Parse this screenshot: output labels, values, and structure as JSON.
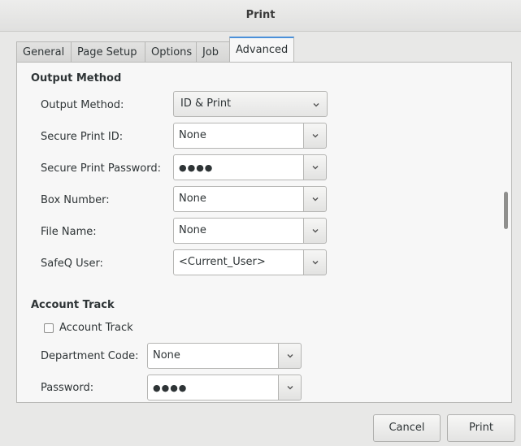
{
  "window": {
    "title": "Print"
  },
  "tabs": [
    {
      "label": "General"
    },
    {
      "label": "Page Setup"
    },
    {
      "label": "Options"
    },
    {
      "label": "Job"
    },
    {
      "label": "Advanced",
      "active": true
    }
  ],
  "output_method": {
    "heading": "Output Method",
    "output_method": {
      "label": "Output Method:",
      "value": "ID & Print"
    },
    "secure_print_id": {
      "label": "Secure Print ID:",
      "value": "None"
    },
    "secure_print_password": {
      "label": "Secure Print Password:",
      "value": "●●●●"
    },
    "box_number": {
      "label": "Box Number:",
      "value": "None"
    },
    "file_name": {
      "label": "File Name:",
      "value": "None"
    },
    "safeq_user": {
      "label": "SafeQ User:",
      "value": "<Current_User>"
    }
  },
  "account_track": {
    "heading": "Account Track",
    "checkbox_label": "Account Track",
    "checked": false,
    "department_code": {
      "label": "Department Code:",
      "value": "None"
    },
    "password": {
      "label": "Password:",
      "value": "●●●●"
    }
  },
  "buttons": {
    "cancel": "Cancel",
    "print": "Print"
  }
}
